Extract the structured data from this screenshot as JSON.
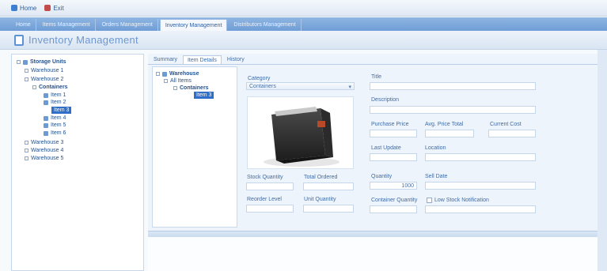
{
  "topbar": {
    "items": [
      {
        "label": "Home",
        "icon": "home-icon"
      },
      {
        "label": "Exit",
        "icon": "exit-icon"
      }
    ]
  },
  "modules": {
    "tabs": [
      {
        "label": "Home"
      },
      {
        "label": "Items Management"
      },
      {
        "label": "Orders Management"
      },
      {
        "label": "Inventory Management"
      },
      {
        "label": "Distributors Management"
      }
    ],
    "active_index": 3
  },
  "page": {
    "title": "Inventory Management"
  },
  "left_tree": {
    "nodes": [
      {
        "label": "Storage Units"
      },
      {
        "label": "Warehouse 1"
      },
      {
        "label": "Warehouse 2"
      },
      {
        "label": "Containers"
      },
      {
        "label": "Item 1"
      },
      {
        "label": "Item 2"
      },
      {
        "label": "Item 3"
      },
      {
        "label": "Item 4"
      },
      {
        "label": "Item 5"
      },
      {
        "label": "Item 6"
      },
      {
        "label": "Warehouse 3"
      },
      {
        "label": "Warehouse 4"
      },
      {
        "label": "Warehouse 5"
      }
    ],
    "selected_index": 6
  },
  "subtabs": {
    "items": [
      {
        "label": "Summary"
      },
      {
        "label": "Item Details"
      },
      {
        "label": "History"
      }
    ],
    "active_index": 1
  },
  "inner_tree": {
    "nodes": [
      {
        "label": "Warehouse"
      },
      {
        "label": "All Items"
      },
      {
        "label": "Containers"
      },
      {
        "label": "Item 3"
      }
    ],
    "selected_index": 3
  },
  "item": {
    "category_label": "Category",
    "category_value": "Containers",
    "image_icon": "folder-box-icon",
    "fields": {
      "title_label": "Title",
      "title_value": "",
      "description_label": "Description",
      "description_value": "",
      "purchase_price_label": "Purchase Price",
      "purchase_price_value": "",
      "avg_price_label": "Avg. Price Total",
      "avg_price_value": "",
      "current_cost_label": "Current Cost",
      "current_cost_value": "",
      "last_update_label": "Last Update",
      "last_update_value": "",
      "location_label": "Location",
      "location_value": "",
      "quantity_label": "Quantity",
      "quantity_value": "1000",
      "date_label": "Sell Date",
      "date_value": "",
      "stock_label": "Stock Quantity",
      "stock_value": "",
      "ordered_label": "Total Ordered",
      "ordered_value": "",
      "reorder_label": "Reorder Level",
      "reorder_value": "",
      "unit_label": "Unit Quantity",
      "unit_value": "",
      "container_label": "Container Quantity",
      "container_value": "",
      "notification_label": "Low Stock Notification"
    }
  },
  "colors": {
    "accent": "#2f6fc9",
    "tab_bar": "#7fa9dc",
    "panel_border": "#c7d6ea"
  }
}
